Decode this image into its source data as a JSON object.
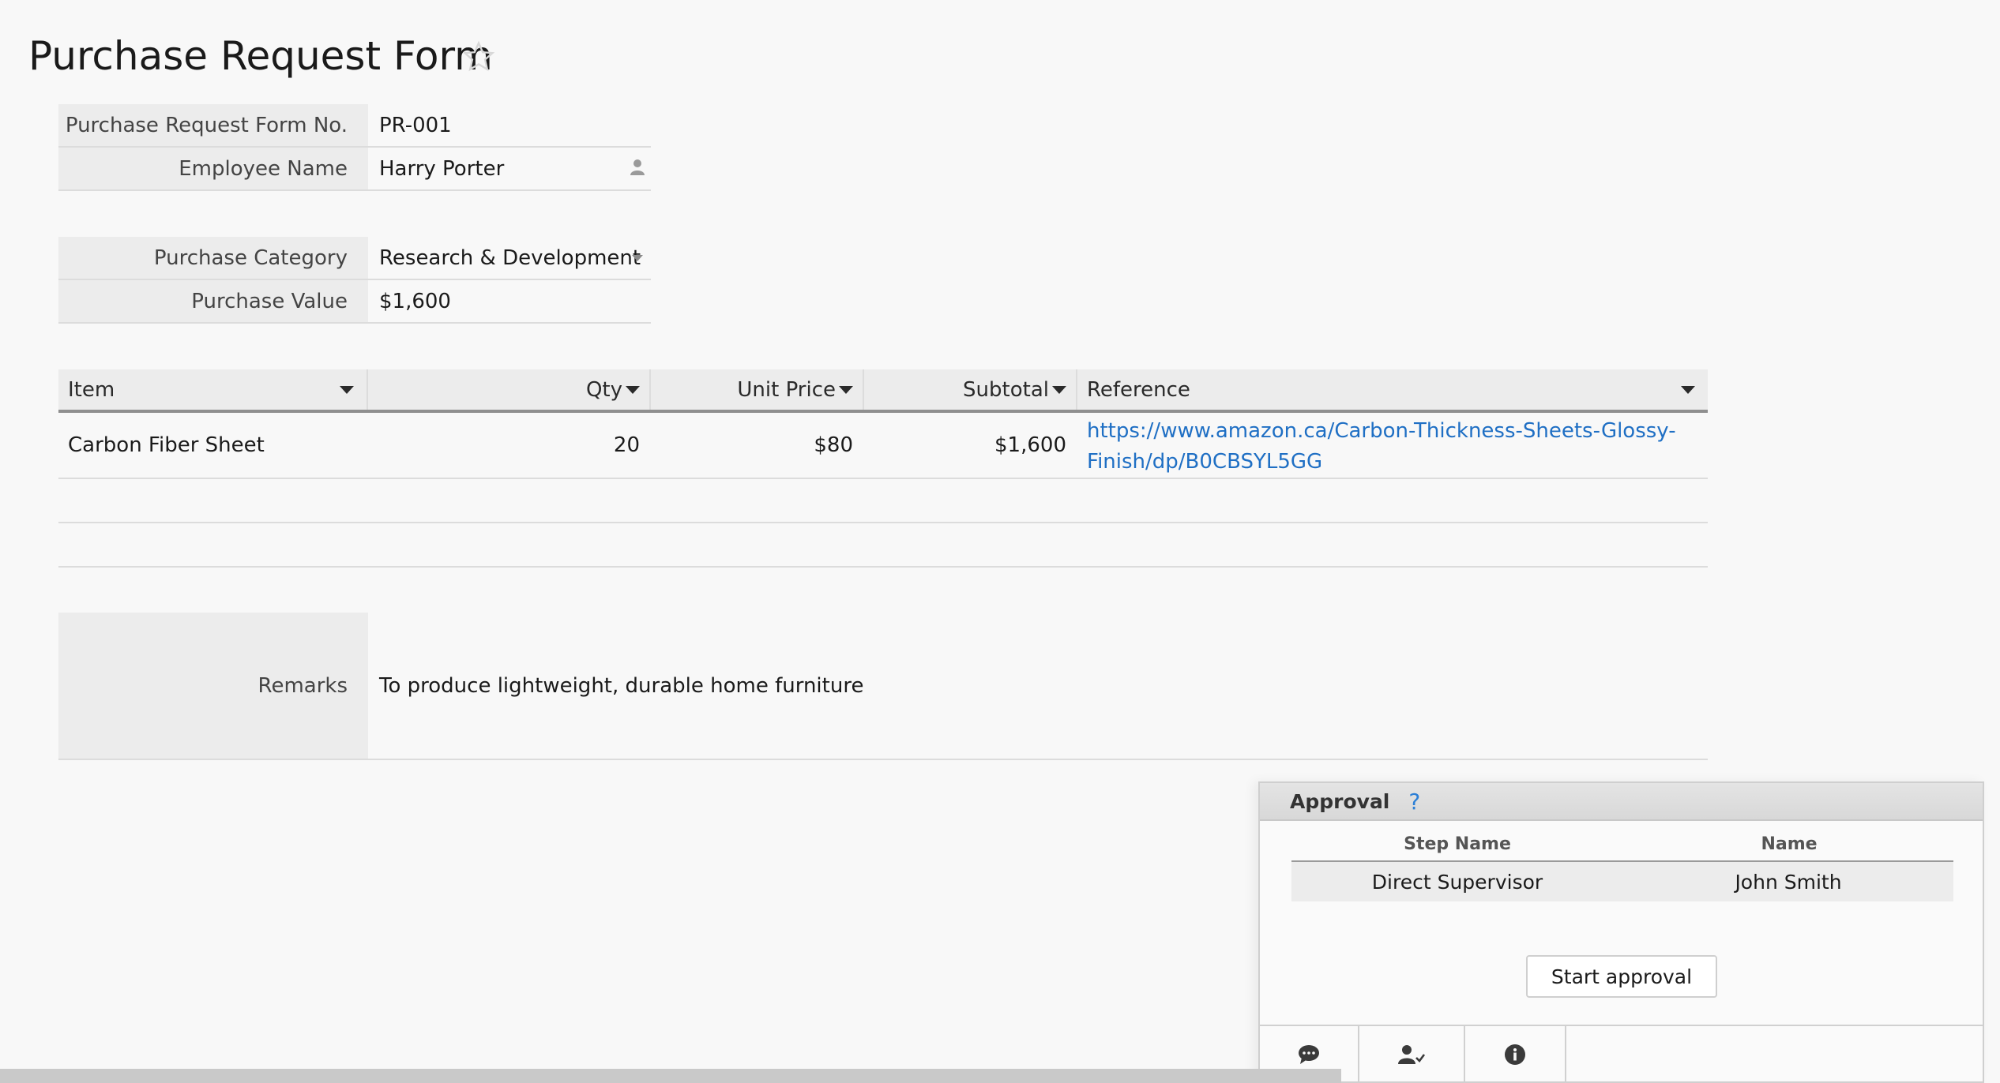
{
  "page": {
    "title": "Purchase Request Form"
  },
  "icons": {
    "favorite": "star-icon",
    "user_picker": "person-icon",
    "dropdown": "caret-down-icon"
  },
  "fields": {
    "form_no": {
      "label": "Purchase Request Form No.",
      "value": "PR-001"
    },
    "employee": {
      "label": "Employee Name",
      "value": "Harry Porter"
    },
    "category": {
      "label": "Purchase Category",
      "value": "Research & Development"
    },
    "value": {
      "label": "Purchase Value",
      "value": "$1,600"
    }
  },
  "items_table": {
    "headers": {
      "item": "Item",
      "qty": "Qty",
      "unit_price": "Unit Price",
      "subtotal": "Subtotal",
      "reference": "Reference"
    },
    "rows": [
      {
        "item": "Carbon Fiber Sheet",
        "qty": "20",
        "unit_price": "$80",
        "subtotal": "$1,600",
        "reference_line1": "https://www.amazon.ca/Carbon-Thickness-Sheets-Glossy-",
        "reference_line2": "Finish/dp/B0CBSYL5GG"
      }
    ]
  },
  "remarks": {
    "label": "Remarks",
    "value": "To produce lightweight, durable home furniture"
  },
  "approval": {
    "title": "Approval",
    "help": "?",
    "headers": {
      "step": "Step Name",
      "name": "Name"
    },
    "rows": [
      {
        "step": "Direct Supervisor",
        "name": "John Smith"
      }
    ],
    "start_button": "Start approval",
    "footer_tabs": [
      "comment-icon",
      "user-check-icon",
      "info-icon"
    ]
  },
  "colors": {
    "link": "#1f6fc4",
    "label_bg": "#ececec",
    "help": "#2c7fd6"
  }
}
